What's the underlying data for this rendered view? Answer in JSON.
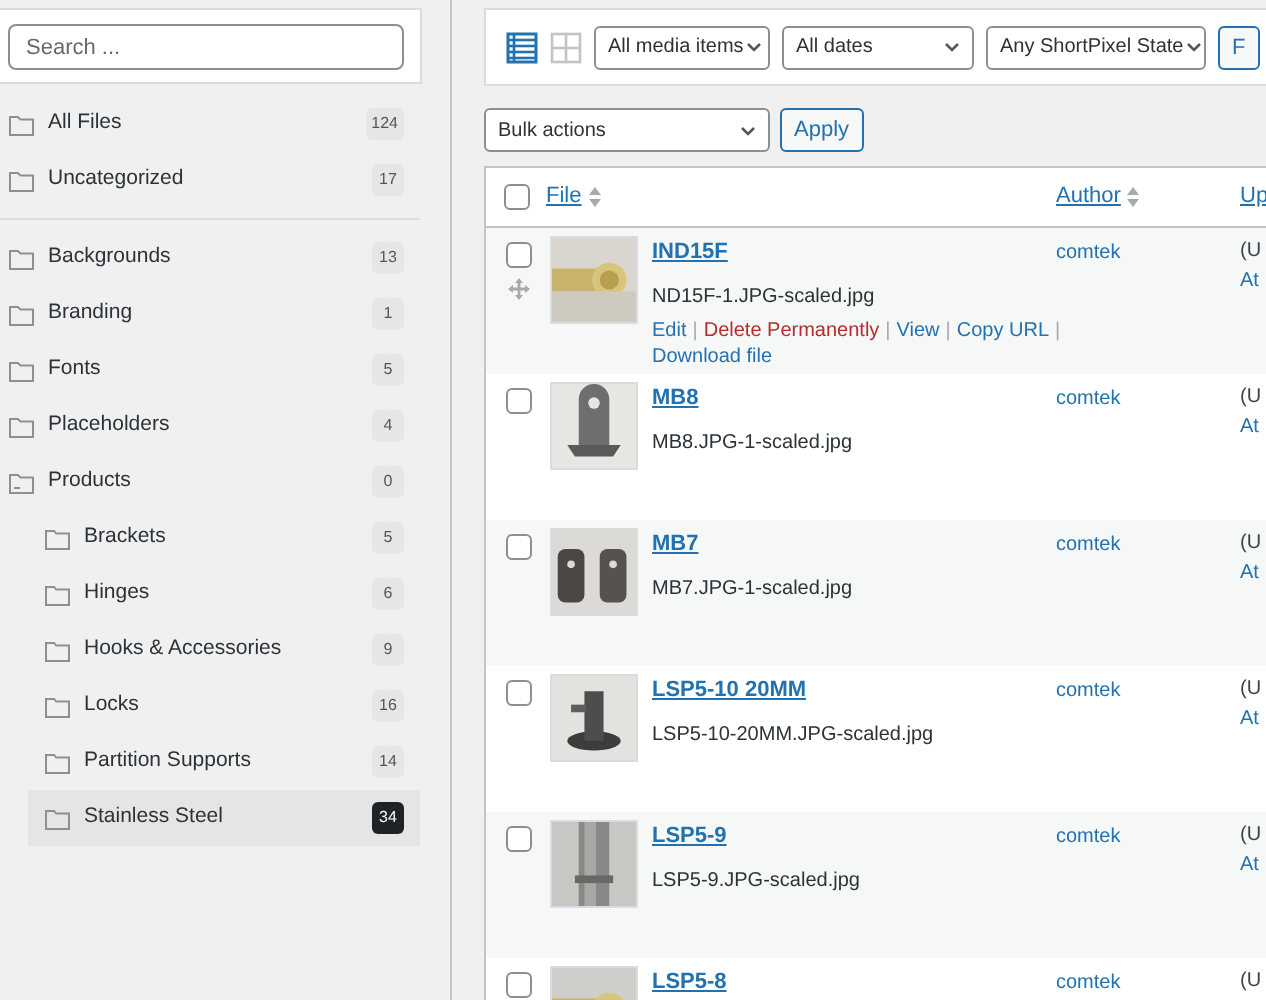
{
  "sidebar": {
    "search": {
      "placeholder": "Search ..."
    },
    "top_items": [
      {
        "label": "All Files",
        "count": "124",
        "selected": false
      },
      {
        "label": "Uncategorized",
        "count": "17",
        "selected": false
      }
    ],
    "folders": [
      {
        "label": "Backgrounds",
        "count": "13",
        "selected": false,
        "expanded": false
      },
      {
        "label": "Branding",
        "count": "1",
        "selected": false,
        "expanded": false
      },
      {
        "label": "Fonts",
        "count": "5",
        "selected": false,
        "expanded": false
      },
      {
        "label": "Placeholders",
        "count": "4",
        "selected": false,
        "expanded": false
      },
      {
        "label": "Products",
        "count": "0",
        "selected": false,
        "expanded": true,
        "children": [
          {
            "label": "Brackets",
            "count": "5",
            "selected": false,
            "expanded": false
          },
          {
            "label": "Hinges",
            "count": "6",
            "selected": false,
            "expanded": false
          },
          {
            "label": "Hooks & Accessories",
            "count": "9",
            "selected": false,
            "expanded": false
          },
          {
            "label": "Locks",
            "count": "16",
            "selected": false,
            "expanded": false
          },
          {
            "label": "Partition Supports",
            "count": "14",
            "selected": false,
            "expanded": false
          },
          {
            "label": "Stainless Steel",
            "count": "34",
            "selected": true,
            "expanded": false
          }
        ]
      }
    ]
  },
  "toolbar": {
    "view_modes": [
      {
        "kind": "list",
        "selected": true
      },
      {
        "kind": "grid",
        "selected": false
      }
    ],
    "filters": [
      "All media items",
      "All dates",
      "Any ShortPixel State"
    ],
    "filter_button": "F"
  },
  "bulk": {
    "select": "Bulk actions",
    "apply": "Apply"
  },
  "table": {
    "select_all_checked": false,
    "columns": [
      {
        "label": "File",
        "sortable": true
      },
      {
        "label": "Author",
        "sortable": true
      },
      {
        "label": "Up",
        "sortable": false
      }
    ],
    "rows": [
      {
        "title": "IND15F",
        "filename": "ND15F-1.JPG-scaled.jpg",
        "author": "comtek",
        "column_3": [
          "(U",
          "At"
        ],
        "checked": false,
        "separator": "|",
        "actions": [
          {
            "label": "Edit",
            "kind": "link"
          },
          {
            "label": "Delete Permanently",
            "kind": "danger"
          },
          {
            "label": "View",
            "kind": "link"
          },
          {
            "label": "Copy URL",
            "kind": "link"
          },
          {
            "label": "Download file",
            "kind": "link"
          }
        ]
      },
      {
        "title": "MB8",
        "filename": "MB8.JPG-1-scaled.jpg",
        "author": "comtek",
        "column_3": [
          "(U",
          "At"
        ],
        "checked": false
      },
      {
        "title": "MB7",
        "filename": "MB7.JPG-1-scaled.jpg",
        "author": "comtek",
        "column_3": [
          "(U",
          "At"
        ],
        "checked": false
      },
      {
        "title": "LSP5-10 20MM",
        "filename": "LSP5-10-20MM.JPG-scaled.jpg",
        "author": "comtek",
        "column_3": [
          "(U",
          "At"
        ],
        "checked": false
      },
      {
        "title": "LSP5-9",
        "filename": "LSP5-9.JPG-scaled.jpg",
        "author": "comtek",
        "column_3": [
          "(U",
          "At"
        ],
        "checked": false
      },
      {
        "title": "LSP5-8",
        "author": "comtek",
        "column_3": [
          "(U"
        ],
        "checked": false
      }
    ]
  }
}
